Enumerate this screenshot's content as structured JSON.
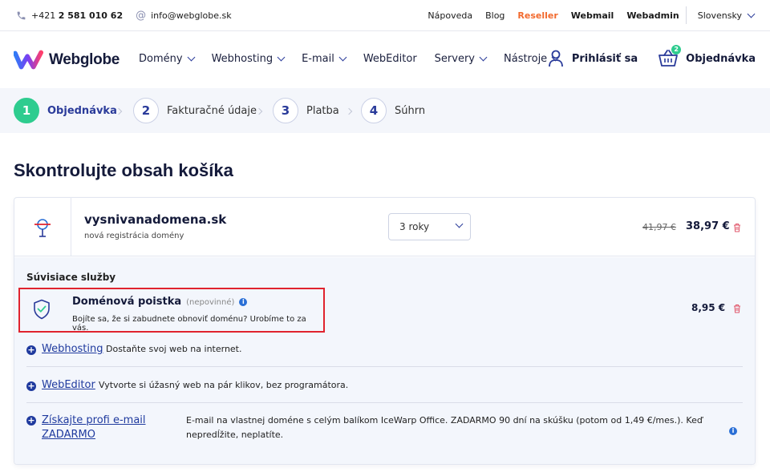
{
  "topbar": {
    "phone_prefix": "+421 ",
    "phone_number": "2 581 010 62",
    "email": "info@webglobe.sk",
    "links": [
      "Nápoveda",
      "Blog",
      "Reseller",
      "Webmail",
      "Webadmin"
    ],
    "language": "Slovensky"
  },
  "header": {
    "logo_text": "Webglobe",
    "nav": [
      "Domény",
      "Webhosting",
      "E-mail",
      "WebEditor",
      "Servery",
      "Nástroje"
    ],
    "login": "Prihlásiť sa",
    "order": "Objednávka",
    "cart_count": "2"
  },
  "steps": [
    {
      "num": "1",
      "label": "Objednávka"
    },
    {
      "num": "2",
      "label": "Fakturačné údaje"
    },
    {
      "num": "3",
      "label": "Platba"
    },
    {
      "num": "4",
      "label": "Súhrn"
    }
  ],
  "page_title": "Skontrolujte obsah košíka",
  "item": {
    "name": "vysnivanadomena.sk",
    "subtitle": "nová registrácia domény",
    "period": "3 roky",
    "old_price": "41,97 €",
    "price": "38,97 €"
  },
  "related": {
    "title": "Súvisiace služby",
    "insurance": {
      "name": "Doménová poistka",
      "optional": "(nepovinné)",
      "info": "i",
      "description": "Bojíte sa, že si zabudnete obnoviť doménu? Urobíme to za vás.",
      "price": "8,95 €"
    },
    "services": [
      {
        "link": "Webhosting",
        "description": "Dostaňte svoj web na internet."
      },
      {
        "link": "WebEditor",
        "description": "Vytvorte si úžasný web na pár klikov, bez programátora."
      }
    ],
    "email": {
      "link_line1": "Získajte profi e-mail",
      "link_line2": "ZADARMO",
      "description": "E-mail na vlastnej doméne s celým balíkom IceWarp Office. ZADARMO 90 dní na skúšku (potom od 1,49 €/mes.). Keď nepredĺžite, neplatíte.",
      "info": "i"
    }
  },
  "colors": {
    "brand_blue": "#1f3a9e",
    "accent_green": "#2ecc8f",
    "reseller_orange": "#f26a2e",
    "highlight_red": "#e0232e"
  }
}
